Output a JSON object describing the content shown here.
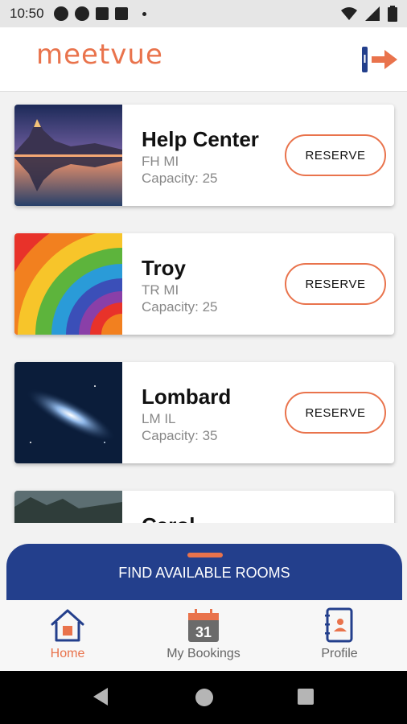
{
  "status_bar": {
    "time": "10:50"
  },
  "header": {
    "logo": "meetvue"
  },
  "rooms": [
    {
      "name": "Help Center",
      "code": "FH MI",
      "capacity": "Capacity: 25",
      "reserve_label": "RESERVE"
    },
    {
      "name": "Troy",
      "code": "TR MI",
      "capacity": "Capacity: 25",
      "reserve_label": "RESERVE"
    },
    {
      "name": "Lombard",
      "code": "LM IL",
      "capacity": "Capacity: 35",
      "reserve_label": "RESERVE"
    },
    {
      "name": "Carol",
      "code": "",
      "capacity": "",
      "reserve_label": ""
    }
  ],
  "find_panel": {
    "label": "FIND AVAILABLE ROOMS"
  },
  "bottom_nav": {
    "home": "Home",
    "bookings": "My Bookings",
    "bookings_day": "31",
    "profile": "Profile",
    "active": "home"
  },
  "colors": {
    "accent": "#e9734c",
    "primary": "#233f8c"
  }
}
